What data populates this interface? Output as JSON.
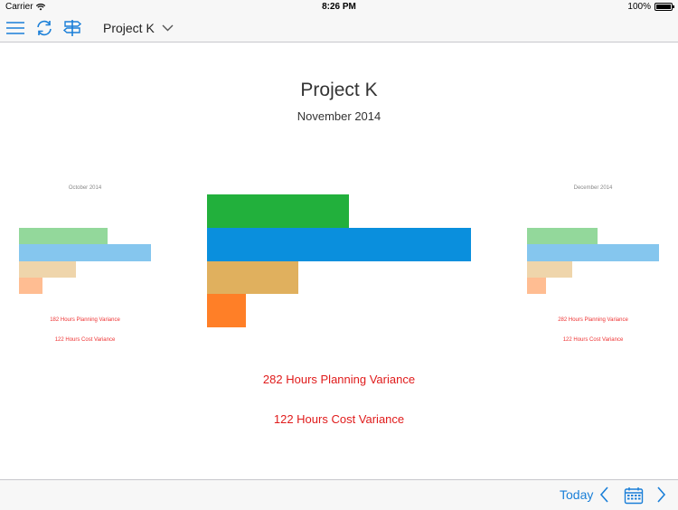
{
  "status": {
    "carrier": "Carrier",
    "time": "8:26 PM",
    "battery": "100%"
  },
  "nav": {
    "title": "Project K",
    "icons": [
      "menu-icon",
      "refresh-icon",
      "signpost-icon",
      "chevron-down-icon"
    ]
  },
  "main": {
    "title": "Project K",
    "period": "November 2014"
  },
  "prev_panel": {
    "period": "October 2014",
    "planning_variance": "182 Hours Planning Variance",
    "cost_variance": "122 Hours Cost Variance"
  },
  "next_panel": {
    "period": "December 2014",
    "planning_variance": "282 Hours Planning Variance",
    "cost_variance": "122 Hours Cost Variance"
  },
  "variance": {
    "planning": "282 Hours Planning Variance",
    "cost": "122 Hours Cost Variance"
  },
  "colors": {
    "green": "#22b03c",
    "blue": "#0a8fdd",
    "tan": "#e0b05e",
    "orange": "#ff7f27",
    "green_light": "#93d89b",
    "blue_light": "#85c6ee",
    "tan_light": "#efd5ab",
    "orange_light": "#ffbd92",
    "accent": "#1a7fd8",
    "variance_red": "#e01b1b"
  },
  "toolbar": {
    "today_label": "Today",
    "icons": [
      "chevron-left-icon",
      "calendar-icon",
      "chevron-right-icon"
    ]
  }
}
